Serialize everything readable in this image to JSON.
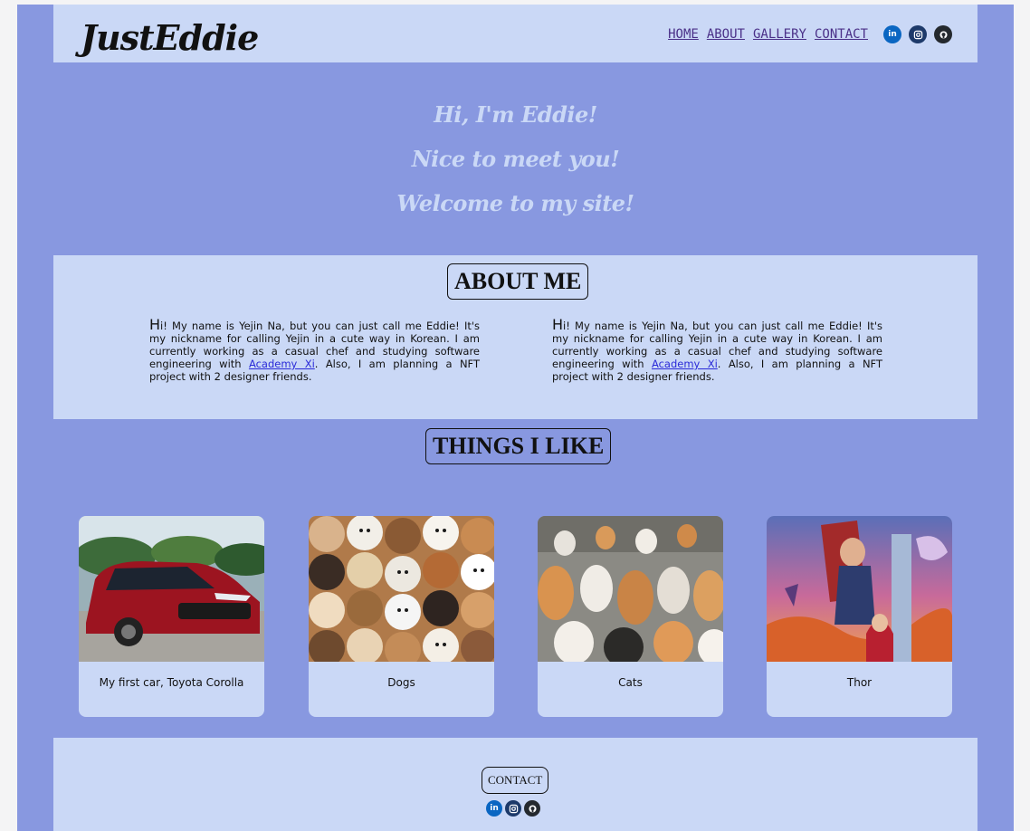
{
  "header": {
    "logo": "JustEddie",
    "nav": [
      "HOME",
      "ABOUT",
      "GALLERY",
      "CONTACT"
    ],
    "social_icons": [
      "linkedin-icon",
      "instagram-icon",
      "github-icon"
    ]
  },
  "hero": {
    "lines": [
      "Hi, I'm Eddie!",
      "Nice to meet you!",
      "Welcome to my site!"
    ]
  },
  "about": {
    "title": "ABOUT ME",
    "paragraph": {
      "first_letter": "H",
      "text_before_link": "i! My name is Yejin Na, but you can just call me Eddie! It's my nickname for calling Yejin in a cute way in Korean. I am currently working as a casual chef and studying software engineering with ",
      "link_text": "Academy Xi",
      "text_after_link": ". Also, I am planning a NFT project with 2 designer friends."
    }
  },
  "things": {
    "title": "THINGS I LIKE",
    "cards": [
      {
        "caption": "My first car, Toyota Corolla"
      },
      {
        "caption": "Dogs"
      },
      {
        "caption": "Cats"
      },
      {
        "caption": "Thor"
      }
    ]
  },
  "footer": {
    "contact_label": "CONTACT"
  },
  "colors": {
    "page_background": "#8898e0",
    "panel_background": "#cad8f6",
    "nav_link": "#4a3088",
    "linkedin": "#0a66c2",
    "instagram": "#1d3a6a",
    "github": "#24292e"
  }
}
